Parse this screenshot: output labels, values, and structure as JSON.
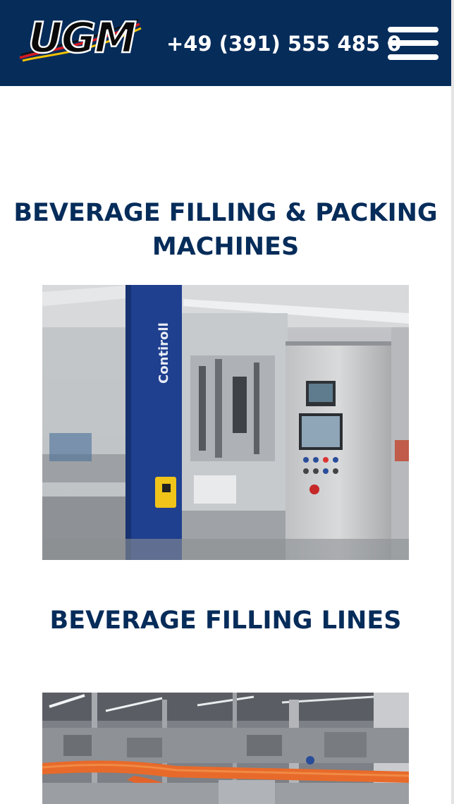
{
  "header": {
    "logo_text": "UGM",
    "phone": "+49 (391) 555 485 0",
    "menu_icon": "hamburger-menu-icon"
  },
  "sections": [
    {
      "title": "BEVERAGE FILLING & PACKING MACHINES",
      "image": "filling-packing-machine-photo",
      "image_label": "Contiroll"
    },
    {
      "title": "BEVERAGE FILLING LINES",
      "image": "filling-line-photo"
    }
  ],
  "colors": {
    "brand_navy": "#062c5a",
    "header_text": "#ffffff",
    "machine_blue": "#1f3f8f",
    "bottle_orange": "#e86a2a"
  }
}
